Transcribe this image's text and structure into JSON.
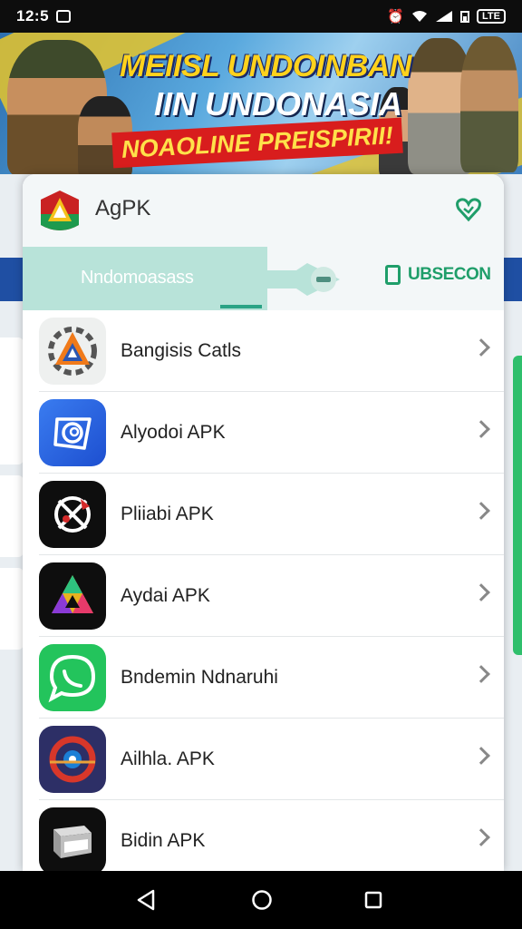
{
  "status_bar": {
    "time": "12:5",
    "battery": "LTE"
  },
  "banner": {
    "line1": "MEIISL UNDOINBAN",
    "line2": "IIN UNDONASIA",
    "line3": "NOAOLINE PREISPIRII!"
  },
  "app_header": {
    "title": "AgPK"
  },
  "tabs": {
    "active_label": "Nndomoasass",
    "right_label": "UBSECON"
  },
  "apps": [
    {
      "label": "Bangisis Catls",
      "icon": "warning-triangle-icon"
    },
    {
      "label": "Alyodoi APK",
      "icon": "spiral-icon"
    },
    {
      "label": "Pliiabi APK",
      "icon": "crossed-circle-icon"
    },
    {
      "label": "Aydai APK",
      "icon": "prism-triangle-icon"
    },
    {
      "label": "Bndemin Ndnaruhi",
      "icon": "chat-bubble-icon"
    },
    {
      "label": "Ailhla. APK",
      "icon": "red-ring-icon"
    },
    {
      "label": "Bidin APK",
      "icon": "box-icon"
    }
  ],
  "colors": {
    "accent_green": "#1f9e6a",
    "tab_bg": "#b8e3d9",
    "chevron": "#888888"
  }
}
